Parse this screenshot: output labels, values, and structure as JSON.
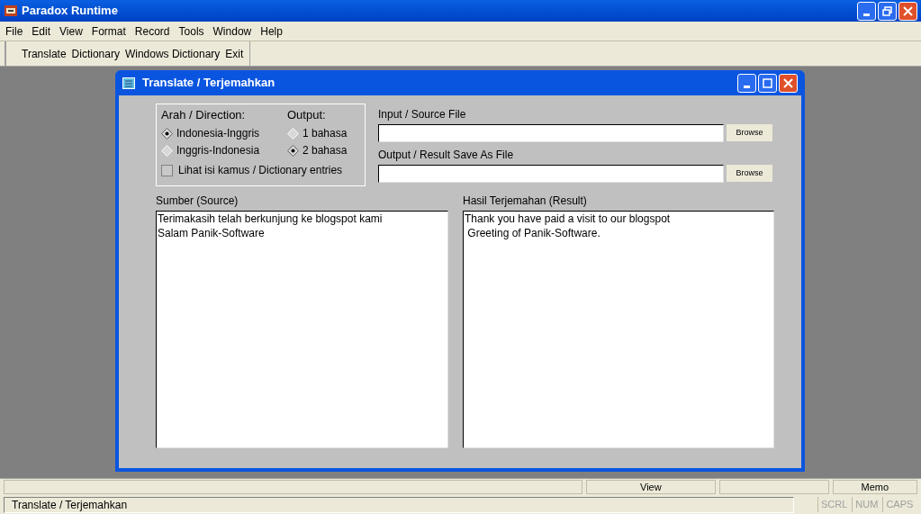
{
  "window": {
    "title": "Paradox Runtime"
  },
  "menu": [
    "File",
    "Edit",
    "View",
    "Format",
    "Record",
    "Tools",
    "Window",
    "Help"
  ],
  "toolbar": [
    "Translate",
    "Dictionary",
    "Windows Dictionary",
    "Exit"
  ],
  "dialog": {
    "title": "Translate / Terjemahkan",
    "direction": {
      "label": "Arah / Direction:",
      "options": [
        {
          "label": "Indonesia-Inggris",
          "selected": true
        },
        {
          "label": "Inggris-Indonesia",
          "selected": false
        }
      ]
    },
    "output": {
      "label": "Output:",
      "options": [
        {
          "label": "1 bahasa",
          "selected": false
        },
        {
          "label": "2 bahasa",
          "selected": true
        }
      ]
    },
    "dictionary_checkbox": {
      "label": "Lihat isi kamus / Dictionary entries",
      "checked": false
    },
    "input_file": {
      "label": "Input / Source File",
      "button": "Browse"
    },
    "output_file": {
      "label": "Output / Result Save As File",
      "button": "Browse"
    },
    "source": {
      "label": "Sumber (Source)",
      "value": "Terimakasih telah berkunjung ke blogspot kami\nSalam Panik-Software"
    },
    "result": {
      "label": "Hasil Terjemahan (Result)",
      "value": "Thank you have paid a visit to our blogspot\n Greeting of Panik-Software."
    }
  },
  "status_bar": {
    "top": [
      "View",
      "Memo"
    ],
    "message": "Translate / Terjemahkan",
    "indicators": [
      "SCRL",
      "NUM",
      "CAPS"
    ]
  }
}
